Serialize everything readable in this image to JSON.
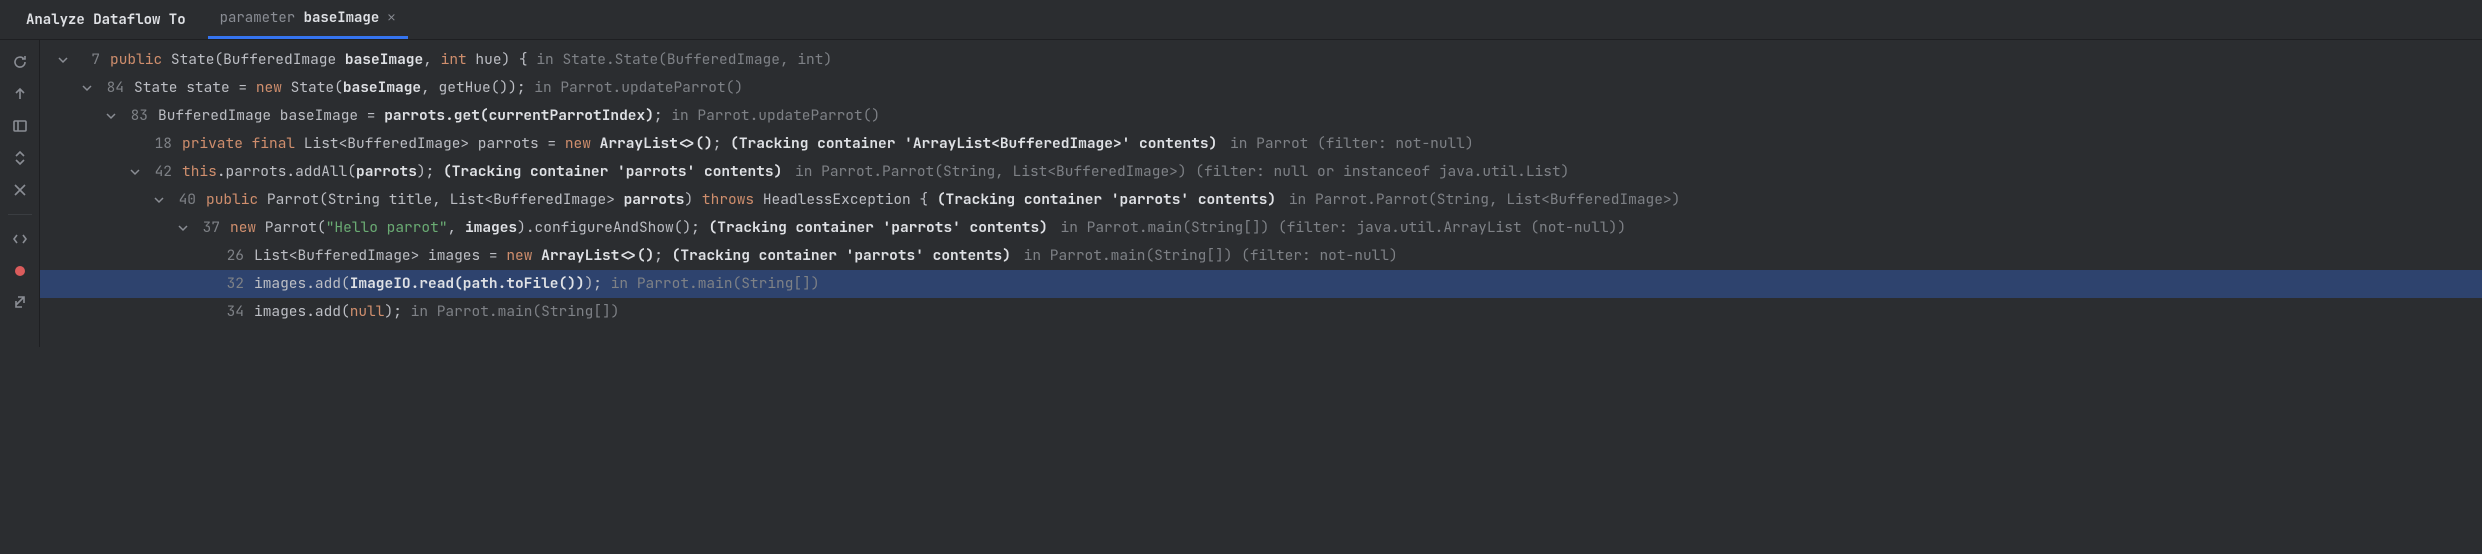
{
  "header": {
    "title": "Analyze Dataflow To",
    "tab": {
      "prefix": "parameter",
      "strong": "baseImage"
    }
  },
  "rows": [
    {
      "depth": 0,
      "chevron": true,
      "line": 7,
      "tokens": [
        {
          "t": "kw",
          "v": "public"
        },
        {
          "t": "txt",
          "v": " State(BufferedImage "
        },
        {
          "t": "bold",
          "v": "baseImage"
        },
        {
          "t": "txt",
          "v": ", "
        },
        {
          "t": "kw",
          "v": "int"
        },
        {
          "t": "txt",
          "v": " hue) { "
        },
        {
          "t": "dim",
          "v": "in State.State(BufferedImage, int)"
        }
      ]
    },
    {
      "depth": 1,
      "chevron": true,
      "line": 84,
      "tokens": [
        {
          "t": "txt",
          "v": "State state = "
        },
        {
          "t": "kw",
          "v": "new"
        },
        {
          "t": "txt",
          "v": " State("
        },
        {
          "t": "bold",
          "v": "baseImage"
        },
        {
          "t": "txt",
          "v": ", getHue()); "
        },
        {
          "t": "dim",
          "v": "in Parrot.updateParrot()"
        }
      ]
    },
    {
      "depth": 2,
      "chevron": true,
      "line": 83,
      "tokens": [
        {
          "t": "txt",
          "v": "BufferedImage baseImage = "
        },
        {
          "t": "bold",
          "v": "parrots.get(currentParrotIndex)"
        },
        {
          "t": "txt",
          "v": "; "
        },
        {
          "t": "dim",
          "v": "in Parrot.updateParrot()"
        }
      ]
    },
    {
      "depth": 3,
      "chevron": false,
      "line": 18,
      "tokens": [
        {
          "t": "kw",
          "v": "private final"
        },
        {
          "t": "txt",
          "v": " List<BufferedImage> parrots = "
        },
        {
          "t": "kw",
          "v": "new"
        },
        {
          "t": "txt",
          "v": " "
        },
        {
          "t": "bold",
          "v": "ArrayList<>()"
        },
        {
          "t": "txt",
          "v": "; "
        },
        {
          "t": "tracking",
          "v": "(Tracking container 'ArrayList<BufferedImage>' contents)"
        },
        {
          "t": "ctx",
          "v": " in Parrot (filter: not-null)"
        }
      ]
    },
    {
      "depth": 3,
      "chevron": true,
      "line": 42,
      "tokens": [
        {
          "t": "kw",
          "v": "this"
        },
        {
          "t": "txt",
          "v": ".parrots.addAll("
        },
        {
          "t": "bold",
          "v": "parrots"
        },
        {
          "t": "txt",
          "v": "); "
        },
        {
          "t": "tracking",
          "v": "(Tracking container 'parrots' contents)"
        },
        {
          "t": "ctx",
          "v": " in Parrot.Parrot(String, List<BufferedImage>) (filter: null or instanceof java.util.List)"
        }
      ]
    },
    {
      "depth": 4,
      "chevron": true,
      "line": 40,
      "tokens": [
        {
          "t": "kw",
          "v": "public"
        },
        {
          "t": "txt",
          "v": " Parrot(String title, List<BufferedImage> "
        },
        {
          "t": "bold",
          "v": "parrots"
        },
        {
          "t": "txt",
          "v": ") "
        },
        {
          "t": "kw",
          "v": "throws"
        },
        {
          "t": "txt",
          "v": " HeadlessException { "
        },
        {
          "t": "tracking",
          "v": "(Tracking container 'parrots' contents)"
        },
        {
          "t": "ctx",
          "v": " in Parrot.Parrot(String, List<BufferedImage>)"
        }
      ]
    },
    {
      "depth": 5,
      "chevron": true,
      "line": 37,
      "tokens": [
        {
          "t": "kw",
          "v": "new"
        },
        {
          "t": "txt",
          "v": " Parrot("
        },
        {
          "t": "str",
          "v": "\"Hello parrot\""
        },
        {
          "t": "txt",
          "v": ", "
        },
        {
          "t": "bold",
          "v": "images"
        },
        {
          "t": "txt",
          "v": ").configureAndShow(); "
        },
        {
          "t": "tracking",
          "v": "(Tracking container 'parrots' contents)"
        },
        {
          "t": "ctx",
          "v": " in Parrot.main(String[]) (filter: java.util.ArrayList (not-null))"
        }
      ]
    },
    {
      "depth": 6,
      "chevron": false,
      "line": 26,
      "tokens": [
        {
          "t": "txt",
          "v": "List<BufferedImage> images = "
        },
        {
          "t": "kw",
          "v": "new"
        },
        {
          "t": "txt",
          "v": " "
        },
        {
          "t": "bold",
          "v": "ArrayList<>()"
        },
        {
          "t": "txt",
          "v": "; "
        },
        {
          "t": "tracking",
          "v": "(Tracking container 'parrots' contents)"
        },
        {
          "t": "ctx",
          "v": " in Parrot.main(String[]) (filter: not-null)"
        }
      ]
    },
    {
      "depth": 6,
      "chevron": false,
      "line": 32,
      "selected": true,
      "tokens": [
        {
          "t": "txt",
          "v": "images.add("
        },
        {
          "t": "bold",
          "v": "ImageIO.read(path.toFile())"
        },
        {
          "t": "txt",
          "v": "); "
        },
        {
          "t": "dim",
          "v": "in Parrot.main(String[])"
        }
      ]
    },
    {
      "depth": 6,
      "chevron": false,
      "line": 34,
      "tokens": [
        {
          "t": "txt",
          "v": "images.add("
        },
        {
          "t": "kw",
          "v": "null"
        },
        {
          "t": "txt",
          "v": "); "
        },
        {
          "t": "dim",
          "v": "in Parrot.main(String[])"
        }
      ]
    }
  ]
}
